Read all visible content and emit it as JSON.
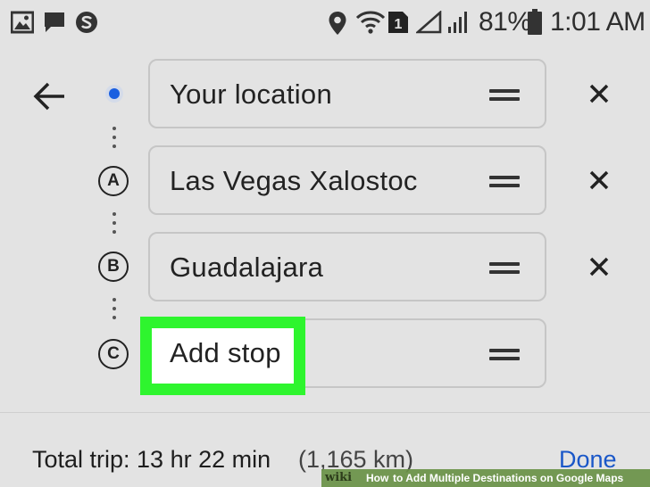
{
  "status_bar": {
    "battery_percent": "81%",
    "time": "1:01 AM",
    "sim_slot": "1",
    "icons": [
      "gallery-notification-icon",
      "message-notification-icon",
      "sync-notification-icon",
      "location-icon",
      "wifi-icon",
      "sim-icon",
      "no-signal-icon",
      "signal-icon",
      "battery-icon"
    ]
  },
  "route": {
    "stops": [
      {
        "marker": "",
        "label": "Your location",
        "removable": true
      },
      {
        "marker": "A",
        "label": "Las Vegas Xalostoc",
        "removable": true
      },
      {
        "marker": "B",
        "label": "Guadalajara",
        "removable": true
      },
      {
        "marker": "C",
        "label": "Add stop",
        "removable": false
      }
    ]
  },
  "footer": {
    "total_trip": "Total trip: 13 hr 22 min",
    "distance": "(1,165 km)",
    "done_label": "Done"
  },
  "watermark": {
    "brand": "wiki",
    "how": "How",
    "title": "to Add Multiple Destinations on Google Maps"
  },
  "colors": {
    "background": "#e3e3e3",
    "location_dot": "#1a5fe0",
    "highlight": "#2ef52e",
    "done_text": "#1a57c8"
  }
}
